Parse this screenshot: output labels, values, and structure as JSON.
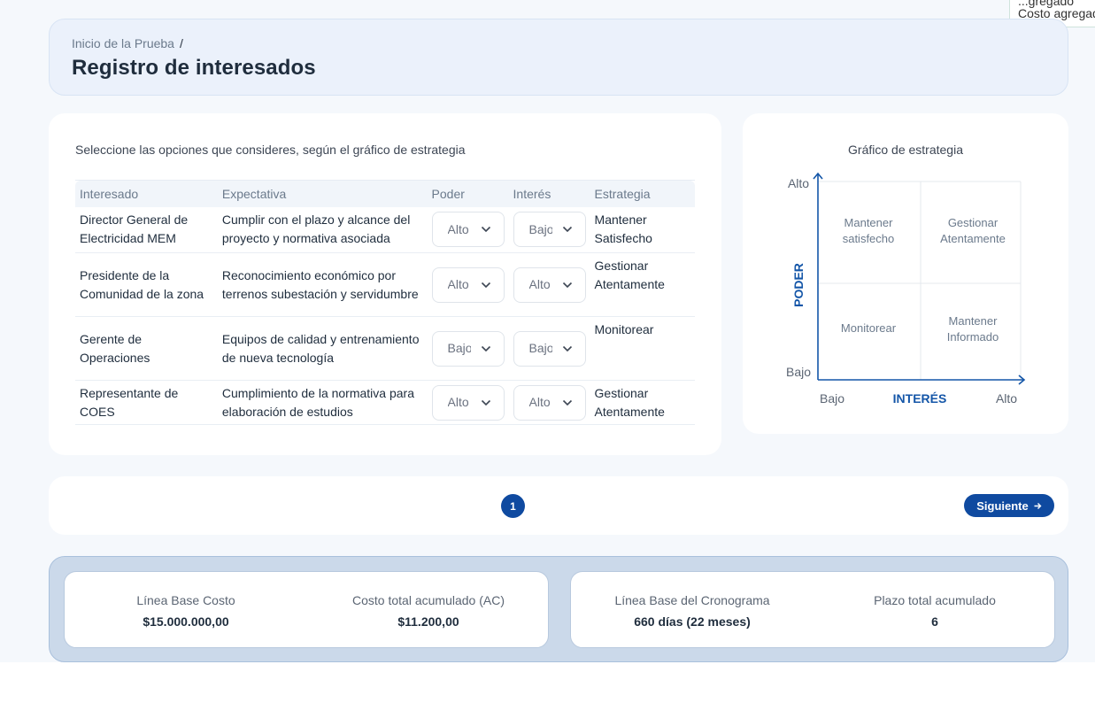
{
  "corner_tooltip": {
    "line1": "...gregado",
    "line2": "Costo agregado"
  },
  "header": {
    "breadcrumb": "Inicio de la Prueba",
    "title": "Registro de interesados"
  },
  "stakeholders": {
    "instructions": "Seleccione las opciones que consideres, según el gráfico de estrategia",
    "columns": [
      "Interesado",
      "Expectativa",
      "Poder",
      "Interés",
      "Estrategia"
    ],
    "rows": [
      {
        "interesado": "Director General de Electricidad MEM",
        "expectativa": "Cumplir con el plazo y alcance del proyecto y normativa asociada",
        "poder": "Alto",
        "interes": "Bajo",
        "estrategia": "Mantener Satisfecho"
      },
      {
        "interesado": "Presidente de la Comunidad de la zona",
        "expectativa": "Reconocimiento económico por terrenos subestación y servidumbre",
        "poder": "Alto",
        "interes": "Alto",
        "estrategia": "Gestionar Atentamente"
      },
      {
        "interesado": "Gerente de Operaciones",
        "expectativa": "Equipos de calidad y entrenamiento de nueva tecnología",
        "poder": "Bajo",
        "interes": "Bajo",
        "estrategia": "Monitorear"
      },
      {
        "interesado": "Representante de COES",
        "expectativa": "Cumplimiento de la normativa para elaboración de estudios",
        "poder": "Alto",
        "interes": "Alto",
        "estrategia": "Gestionar Atentamente"
      }
    ]
  },
  "strategy_chart": {
    "title": "Gráfico de estrategia",
    "y_axis_label": "PODER",
    "x_axis_label": "INTERÉS",
    "y_high": "Alto",
    "y_low": "Bajo",
    "x_low": "Bajo",
    "x_high": "Alto",
    "quadrants": {
      "top_left": [
        "Mantener",
        "satisfecho"
      ],
      "top_right": [
        "Gestionar",
        "Atentamente"
      ],
      "bottom_left": [
        "Monitorear"
      ],
      "bottom_right": [
        "Mantener",
        "Informado"
      ]
    },
    "axis_color": "#1456a8"
  },
  "pagination": {
    "current_page": "1",
    "next_label": "Siguiente"
  },
  "summary": {
    "cost_baseline_label": "Línea Base Costo",
    "cost_baseline_value": "$15.000.000,00",
    "ac_label": "Costo total acumulado (AC)",
    "ac_value": "$11.200,00",
    "schedule_baseline_label": "Línea Base del Cronograma",
    "schedule_baseline_value": "660 días (22 meses)",
    "term_label": "Plazo total acumulado",
    "term_value": "6"
  }
}
